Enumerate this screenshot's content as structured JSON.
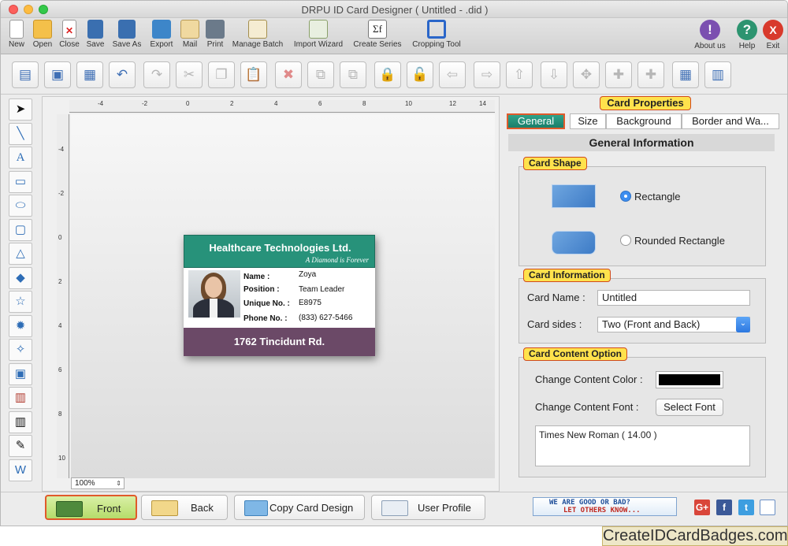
{
  "window": {
    "title": "DRPU ID Card Designer ( Untitled -  .did )"
  },
  "toolbar": {
    "left": [
      {
        "label": "New",
        "icon": "new-icon"
      },
      {
        "label": "Open",
        "icon": "open-icon"
      },
      {
        "label": "Close",
        "icon": "close-file-icon"
      },
      {
        "label": "Save",
        "icon": "save-icon"
      },
      {
        "label": "Save As",
        "icon": "save-as-icon"
      },
      {
        "label": "Export",
        "icon": "export-icon"
      },
      {
        "label": "Mail",
        "icon": "mail-icon"
      },
      {
        "label": "Print",
        "icon": "print-icon"
      },
      {
        "label": "Manage Batch",
        "icon": "manage-batch-icon"
      },
      {
        "label": "Import Wizard",
        "icon": "import-wizard-icon"
      },
      {
        "label": "Create Series",
        "icon": "create-series-icon"
      },
      {
        "label": "Cropping Tool",
        "icon": "cropping-tool-icon"
      }
    ],
    "right": [
      {
        "label": "About us",
        "icon": "about-icon",
        "glyph": "!"
      },
      {
        "label": "Help",
        "icon": "help-icon",
        "glyph": "?"
      },
      {
        "label": "Exit",
        "icon": "exit-icon",
        "glyph": "X"
      }
    ]
  },
  "canvas": {
    "zoom": "100%",
    "ruler_top": [
      "-4",
      "-2",
      "0",
      "2",
      "4",
      "6",
      "8",
      "10",
      "12",
      "14"
    ],
    "ruler_left": [
      "-4",
      "-2",
      "0",
      "2",
      "4",
      "6",
      "8",
      "10"
    ]
  },
  "card": {
    "company": "Healthcare Technologies Ltd.",
    "tagline": "A Diamond is Forever",
    "fields": [
      {
        "label": "Name :",
        "value": "Zoya"
      },
      {
        "label": "Position :",
        "value": "Team Leader"
      },
      {
        "label": "Unique No. :",
        "value": "E8975"
      },
      {
        "label": "Phone No. :",
        "value": "(833) 627-5466"
      }
    ],
    "address": "1762 Tincidunt Rd.",
    "colors": {
      "header": "#27927a",
      "footer": "#6b4967"
    }
  },
  "panel": {
    "title": "Card Properties",
    "tabs": [
      "General",
      "Size",
      "Background",
      "Border and Wa..."
    ],
    "active_tab": "General",
    "header": "General Information",
    "card_shape": {
      "title": "Card Shape",
      "options": [
        "Rectangle",
        "Rounded Rectangle"
      ],
      "selected": "Rectangle"
    },
    "card_info": {
      "title": "Card Information",
      "name_label": "Card Name :",
      "name_value": "Untitled",
      "sides_label": "Card sides :",
      "sides_value": "Two (Front and Back)"
    },
    "content_option": {
      "title": "Card Content Option",
      "color_label": "Change Content Color :",
      "color_value": "#000000",
      "font_label": "Change Content Font :",
      "font_button": "Select Font",
      "font_value": "Times New Roman ( 14.00 )"
    }
  },
  "bottom": {
    "buttons": [
      {
        "label": "Front",
        "icon": "front-card-icon"
      },
      {
        "label": "Back",
        "icon": "back-card-icon"
      },
      {
        "label": "Copy Card Design",
        "icon": "copy-design-icon"
      },
      {
        "label": "User Profile",
        "icon": "user-profile-icon"
      }
    ],
    "feedback_line1": "WE ARE GOOD OR BAD?",
    "feedback_line2": "LET OTHERS KNOW...",
    "social": [
      "G+",
      "f",
      "t",
      "share"
    ]
  },
  "brand": "CreateIDCardBadges.com"
}
